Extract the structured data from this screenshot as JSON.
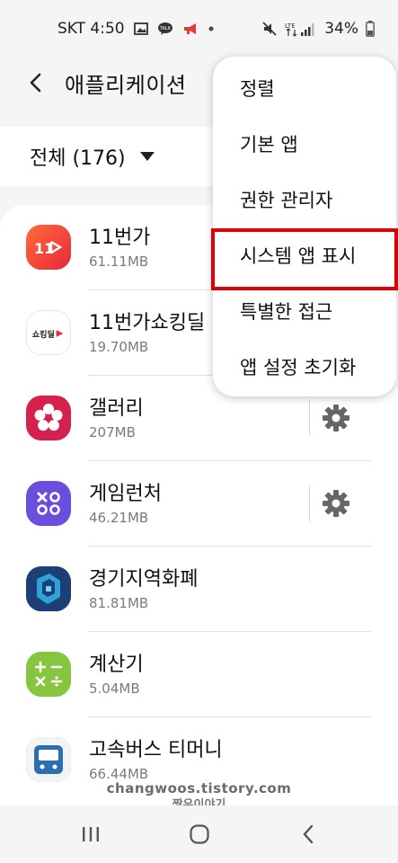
{
  "status_bar": {
    "carrier_time": "SKT 4:50",
    "notif_icons": [
      "image-icon",
      "talk-icon",
      "megaphone-icon",
      "dot-icon"
    ],
    "right_icons": [
      "mute-icon",
      "lte-signal-icon"
    ],
    "lte_label": "LTE",
    "battery": "34%"
  },
  "app_bar": {
    "title": "애플리케이션"
  },
  "filter": {
    "label": "전체 (176)"
  },
  "apps": [
    {
      "name": "11번가",
      "size": "61.11MB",
      "icon": "elevenst-icon",
      "color": "#f5452b",
      "has_gear": false
    },
    {
      "name": "11번가쇼킹딜",
      "size": "19.70MB",
      "icon": "shocking-deal-icon",
      "color": "#ffffff",
      "has_gear": false
    },
    {
      "name": "갤러리",
      "size": "207MB",
      "icon": "gallery-flower-icon",
      "color": "#d6204e",
      "has_gear": true
    },
    {
      "name": "게임런처",
      "size": "46.21MB",
      "icon": "game-launcher-icon",
      "color": "#6a4ee0",
      "has_gear": true
    },
    {
      "name": "경기지역화폐",
      "size": "81.81MB",
      "icon": "gyeonggi-currency-icon",
      "color": "#1f4f8f",
      "has_gear": false
    },
    {
      "name": "계산기",
      "size": "5.04MB",
      "icon": "calculator-icon",
      "color": "#86c53f",
      "has_gear": false
    },
    {
      "name": "고속버스 티머니",
      "size": "66.44MB",
      "icon": "bus-icon",
      "color": "#2b6fb2",
      "has_gear": false
    }
  ],
  "menu": {
    "items": [
      "정렬",
      "기본 앱",
      "권한 관리자",
      "시스템 앱 표시",
      "특별한 접근",
      "앱 설정 초기화"
    ],
    "highlighted_index": 3,
    "highlight_color": "#e0000a"
  },
  "watermark": {
    "line1": "changwoos.tistory.com",
    "line2": "짱우이야기"
  },
  "nav_bar": {
    "buttons": [
      "recent-apps-icon",
      "home-icon",
      "back-icon"
    ]
  }
}
